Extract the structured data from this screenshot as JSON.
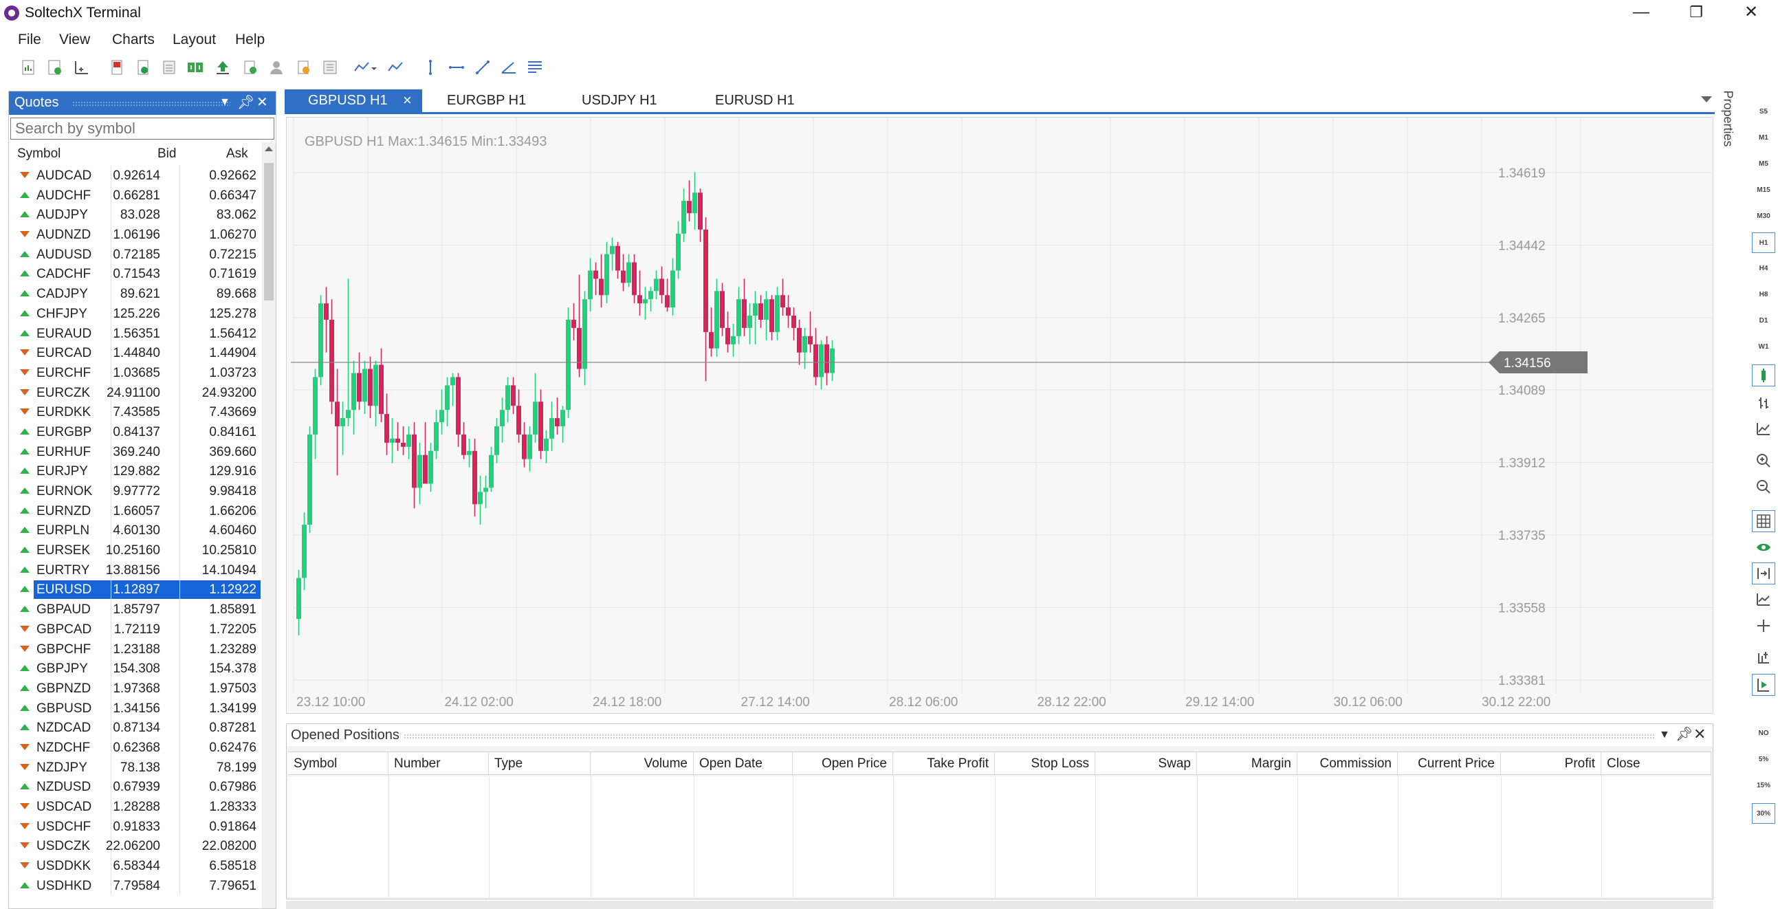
{
  "window": {
    "title": "SoltechX Terminal",
    "minimize": "—",
    "restore": "❐",
    "close": "✕"
  },
  "menu": [
    "File",
    "View",
    "Charts",
    "Layout",
    "Help"
  ],
  "quotes": {
    "title": "Quotes",
    "search_placeholder": "Search by symbol",
    "columns": [
      "Symbol",
      "Bid",
      "Ask"
    ],
    "selected_symbol": "EURUSD",
    "rows": [
      {
        "symbol": "AUDCAD",
        "bid": "0.92614",
        "ask": "0.92662",
        "dir": "down"
      },
      {
        "symbol": "AUDCHF",
        "bid": "0.66281",
        "ask": "0.66347",
        "dir": "up"
      },
      {
        "symbol": "AUDJPY",
        "bid": "83.028",
        "ask": "83.062",
        "dir": "up"
      },
      {
        "symbol": "AUDNZD",
        "bid": "1.06196",
        "ask": "1.06270",
        "dir": "down"
      },
      {
        "symbol": "AUDUSD",
        "bid": "0.72185",
        "ask": "0.72215",
        "dir": "up"
      },
      {
        "symbol": "CADCHF",
        "bid": "0.71543",
        "ask": "0.71619",
        "dir": "up"
      },
      {
        "symbol": "CADJPY",
        "bid": "89.621",
        "ask": "89.668",
        "dir": "up"
      },
      {
        "symbol": "CHFJPY",
        "bid": "125.226",
        "ask": "125.278",
        "dir": "up"
      },
      {
        "symbol": "EURAUD",
        "bid": "1.56351",
        "ask": "1.56412",
        "dir": "up"
      },
      {
        "symbol": "EURCAD",
        "bid": "1.44840",
        "ask": "1.44904",
        "dir": "down"
      },
      {
        "symbol": "EURCHF",
        "bid": "1.03685",
        "ask": "1.03723",
        "dir": "down"
      },
      {
        "symbol": "EURCZK",
        "bid": "24.91100",
        "ask": "24.93200",
        "dir": "down"
      },
      {
        "symbol": "EURDKK",
        "bid": "7.43585",
        "ask": "7.43669",
        "dir": "down"
      },
      {
        "symbol": "EURGBP",
        "bid": "0.84137",
        "ask": "0.84161",
        "dir": "up"
      },
      {
        "symbol": "EURHUF",
        "bid": "369.240",
        "ask": "369.660",
        "dir": "up"
      },
      {
        "symbol": "EURJPY",
        "bid": "129.882",
        "ask": "129.916",
        "dir": "up"
      },
      {
        "symbol": "EURNOK",
        "bid": "9.97772",
        "ask": "9.98418",
        "dir": "up"
      },
      {
        "symbol": "EURNZD",
        "bid": "1.66057",
        "ask": "1.66206",
        "dir": "up"
      },
      {
        "symbol": "EURPLN",
        "bid": "4.60130",
        "ask": "4.60460",
        "dir": "up"
      },
      {
        "symbol": "EURSEK",
        "bid": "10.25160",
        "ask": "10.25810",
        "dir": "up"
      },
      {
        "symbol": "EURTRY",
        "bid": "13.88156",
        "ask": "14.10494",
        "dir": "up"
      },
      {
        "symbol": "EURUSD",
        "bid": "1.12897",
        "ask": "1.12922",
        "dir": "up"
      },
      {
        "symbol": "GBPAUD",
        "bid": "1.85797",
        "ask": "1.85891",
        "dir": "up"
      },
      {
        "symbol": "GBPCAD",
        "bid": "1.72119",
        "ask": "1.72205",
        "dir": "down"
      },
      {
        "symbol": "GBPCHF",
        "bid": "1.23188",
        "ask": "1.23289",
        "dir": "down"
      },
      {
        "symbol": "GBPJPY",
        "bid": "154.308",
        "ask": "154.378",
        "dir": "up"
      },
      {
        "symbol": "GBPNZD",
        "bid": "1.97368",
        "ask": "1.97503",
        "dir": "up"
      },
      {
        "symbol": "GBPUSD",
        "bid": "1.34156",
        "ask": "1.34199",
        "dir": "up"
      },
      {
        "symbol": "NZDCAD",
        "bid": "0.87134",
        "ask": "0.87281",
        "dir": "up"
      },
      {
        "symbol": "NZDCHF",
        "bid": "0.62368",
        "ask": "0.62476",
        "dir": "down"
      },
      {
        "symbol": "NZDJPY",
        "bid": "78.138",
        "ask": "78.199",
        "dir": "down"
      },
      {
        "symbol": "NZDUSD",
        "bid": "0.67939",
        "ask": "0.67986",
        "dir": "up"
      },
      {
        "symbol": "USDCAD",
        "bid": "1.28288",
        "ask": "1.28333",
        "dir": "down"
      },
      {
        "symbol": "USDCHF",
        "bid": "0.91833",
        "ask": "0.91864",
        "dir": "down"
      },
      {
        "symbol": "USDCZK",
        "bid": "22.06200",
        "ask": "22.08200",
        "dir": "down"
      },
      {
        "symbol": "USDDKK",
        "bid": "6.58344",
        "ask": "6.58518",
        "dir": "down"
      },
      {
        "symbol": "USDHKD",
        "bid": "7.79584",
        "ask": "7.79651",
        "dir": "up"
      }
    ]
  },
  "tabs": [
    "GBPUSD H1",
    "EURGBP H1",
    "USDJPY H1",
    "EURUSD H1"
  ],
  "tab_close": "×",
  "chart": {
    "info": "GBPUSD H1  Max:1.34615 Min:1.33493",
    "current_price": "1.34156",
    "colors": {
      "bull": "#1fd17a",
      "bear": "#d6245a",
      "grid": "#e4e4e4",
      "price_line": "#888888",
      "price_tag": "#777777"
    }
  },
  "chart_data": {
    "type": "candlestick",
    "symbol": "GBPUSD",
    "timeframe": "H1",
    "ylim": [
      1.333,
      1.347
    ],
    "y_ticks": [
      "1.34619",
      "1.34442",
      "1.34265",
      "1.34089",
      "1.33912",
      "1.33735",
      "1.33558",
      "1.33381"
    ],
    "y_tick_values": [
      1.34619,
      1.34442,
      1.34265,
      1.34089,
      1.33912,
      1.33735,
      1.33558,
      1.33381
    ],
    "x_ticks": [
      "23.12 10:00",
      "24.12 02:00",
      "24.12 18:00",
      "27.12 14:00",
      "28.12 06:00",
      "28.12 22:00",
      "29.12 14:00",
      "30.12 06:00",
      "30.12 22:00"
    ],
    "current_price": 1.34156,
    "candles": [
      [
        1.3353,
        1.3365,
        1.3349,
        1.3363
      ],
      [
        1.3363,
        1.3379,
        1.336,
        1.3376
      ],
      [
        1.3376,
        1.34,
        1.3374,
        1.3398
      ],
      [
        1.3398,
        1.3414,
        1.3392,
        1.3412
      ],
      [
        1.3412,
        1.3432,
        1.341,
        1.343
      ],
      [
        1.343,
        1.3434,
        1.3418,
        1.3426
      ],
      [
        1.3426,
        1.3431,
        1.3403,
        1.3406
      ],
      [
        1.3406,
        1.3414,
        1.3388,
        1.34
      ],
      [
        1.34,
        1.3406,
        1.3393,
        1.3402
      ],
      [
        1.3402,
        1.3436,
        1.34,
        1.3404
      ],
      [
        1.3404,
        1.3416,
        1.3398,
        1.3413
      ],
      [
        1.3413,
        1.3418,
        1.3404,
        1.3406
      ],
      [
        1.3406,
        1.3416,
        1.3403,
        1.3414
      ],
      [
        1.3414,
        1.3417,
        1.3402,
        1.3405
      ],
      [
        1.3405,
        1.3416,
        1.34,
        1.3415
      ],
      [
        1.3415,
        1.3419,
        1.3401,
        1.3403
      ],
      [
        1.3403,
        1.3408,
        1.3393,
        1.3396
      ],
      [
        1.3396,
        1.3402,
        1.3391,
        1.3397
      ],
      [
        1.3397,
        1.3401,
        1.3394,
        1.3396
      ],
      [
        1.3396,
        1.34,
        1.3393,
        1.3395
      ],
      [
        1.3395,
        1.34,
        1.3392,
        1.3398
      ],
      [
        1.3398,
        1.3401,
        1.338,
        1.3385
      ],
      [
        1.3385,
        1.3396,
        1.3381,
        1.3393
      ],
      [
        1.3393,
        1.3401,
        1.339,
        1.3386
      ],
      [
        1.3386,
        1.3396,
        1.3384,
        1.3394
      ],
      [
        1.3394,
        1.3404,
        1.3392,
        1.3401
      ],
      [
        1.3401,
        1.3409,
        1.3398,
        1.3404
      ],
      [
        1.3404,
        1.3412,
        1.34,
        1.341
      ],
      [
        1.341,
        1.3413,
        1.3405,
        1.3412
      ],
      [
        1.3412,
        1.3413,
        1.3395,
        1.3398
      ],
      [
        1.3398,
        1.3401,
        1.3392,
        1.3393
      ],
      [
        1.3393,
        1.3397,
        1.339,
        1.3394
      ],
      [
        1.3394,
        1.3397,
        1.3378,
        1.3381
      ],
      [
        1.3381,
        1.3388,
        1.3376,
        1.3384
      ],
      [
        1.3384,
        1.3388,
        1.338,
        1.3385
      ],
      [
        1.3385,
        1.3395,
        1.3384,
        1.3393
      ],
      [
        1.3393,
        1.3402,
        1.3391,
        1.34
      ],
      [
        1.34,
        1.3407,
        1.3396,
        1.3404
      ],
      [
        1.3404,
        1.3412,
        1.3401,
        1.341
      ],
      [
        1.341,
        1.3412,
        1.3403,
        1.3405
      ],
      [
        1.3405,
        1.3409,
        1.3396,
        1.3398
      ],
      [
        1.3398,
        1.3401,
        1.339,
        1.3392
      ],
      [
        1.3392,
        1.34,
        1.3389,
        1.3398
      ],
      [
        1.3398,
        1.3413,
        1.3396,
        1.3406
      ],
      [
        1.3406,
        1.3409,
        1.3392,
        1.3394
      ],
      [
        1.3394,
        1.3399,
        1.3391,
        1.3397
      ],
      [
        1.3397,
        1.3406,
        1.3394,
        1.3402
      ],
      [
        1.3402,
        1.3407,
        1.3398,
        1.34
      ],
      [
        1.34,
        1.3405,
        1.3396,
        1.3404
      ],
      [
        1.3404,
        1.3429,
        1.3402,
        1.3426
      ],
      [
        1.3426,
        1.343,
        1.3421,
        1.3424
      ],
      [
        1.3424,
        1.3437,
        1.3412,
        1.3414
      ],
      [
        1.3414,
        1.3433,
        1.341,
        1.3431
      ],
      [
        1.3431,
        1.3441,
        1.3428,
        1.3438
      ],
      [
        1.3438,
        1.344,
        1.3432,
        1.3436
      ],
      [
        1.3436,
        1.3442,
        1.3429,
        1.3432
      ],
      [
        1.3432,
        1.3445,
        1.343,
        1.3442
      ],
      [
        1.3442,
        1.3446,
        1.3438,
        1.3444
      ],
      [
        1.3444,
        1.3445,
        1.3436,
        1.3438
      ],
      [
        1.3438,
        1.3442,
        1.3433,
        1.3435
      ],
      [
        1.3435,
        1.3442,
        1.3434,
        1.344
      ],
      [
        1.344,
        1.3442,
        1.343,
        1.3432
      ],
      [
        1.3432,
        1.3438,
        1.3427,
        1.343
      ],
      [
        1.343,
        1.3434,
        1.3426,
        1.3431
      ],
      [
        1.3431,
        1.3434,
        1.3428,
        1.3433
      ],
      [
        1.3433,
        1.3438,
        1.3431,
        1.3436
      ],
      [
        1.3436,
        1.3439,
        1.343,
        1.3432
      ],
      [
        1.3432,
        1.3436,
        1.3428,
        1.3429
      ],
      [
        1.3429,
        1.3441,
        1.3427,
        1.3438
      ],
      [
        1.3438,
        1.345,
        1.3436,
        1.3447
      ],
      [
        1.3447,
        1.3458,
        1.3445,
        1.3455
      ],
      [
        1.3455,
        1.346,
        1.345,
        1.3452
      ],
      [
        1.3452,
        1.3462,
        1.3448,
        1.3457
      ],
      [
        1.3457,
        1.3458,
        1.3445,
        1.3448
      ],
      [
        1.3448,
        1.3451,
        1.3411,
        1.3423
      ],
      [
        1.3423,
        1.3429,
        1.3417,
        1.3419
      ],
      [
        1.3419,
        1.3436,
        1.3417,
        1.3433
      ],
      [
        1.3433,
        1.3435,
        1.3422,
        1.3424
      ],
      [
        1.3424,
        1.3428,
        1.3418,
        1.342
      ],
      [
        1.342,
        1.3425,
        1.3417,
        1.3422
      ],
      [
        1.3422,
        1.3434,
        1.342,
        1.3431
      ],
      [
        1.3431,
        1.3436,
        1.3422,
        1.3424
      ],
      [
        1.3424,
        1.343,
        1.342,
        1.3427
      ],
      [
        1.3427,
        1.3433,
        1.342,
        1.343
      ],
      [
        1.343,
        1.3432,
        1.3424,
        1.3426
      ],
      [
        1.3426,
        1.3433,
        1.3421,
        1.3431
      ],
      [
        1.3431,
        1.3432,
        1.3421,
        1.3423
      ],
      [
        1.3423,
        1.3434,
        1.3421,
        1.3432
      ],
      [
        1.3432,
        1.3436,
        1.3427,
        1.3429
      ],
      [
        1.3429,
        1.3432,
        1.3424,
        1.3427
      ],
      [
        1.3427,
        1.3429,
        1.3421,
        1.3424
      ],
      [
        1.3424,
        1.3426,
        1.3415,
        1.3418
      ],
      [
        1.3418,
        1.3424,
        1.3414,
        1.3422
      ],
      [
        1.3422,
        1.3428,
        1.3418,
        1.342
      ],
      [
        1.342,
        1.3424,
        1.341,
        1.3412
      ],
      [
        1.3412,
        1.3421,
        1.3409,
        1.342
      ],
      [
        1.342,
        1.3422,
        1.341,
        1.3413
      ],
      [
        1.3413,
        1.3421,
        1.3411,
        1.3419
      ]
    ]
  },
  "right_bar": {
    "properties": "Properties",
    "timeframes": [
      "S5",
      "M1",
      "M5",
      "M15",
      "M30",
      "H1",
      "H4",
      "H8",
      "D1",
      "W1"
    ],
    "selected_timeframe": "H1",
    "volumes": [
      "NO",
      "5%",
      "15%",
      "30%"
    ],
    "selected_volume": "30%"
  },
  "positions": {
    "title": "Opened Positions",
    "columns": [
      "Symbol",
      "Number",
      "Type",
      "Volume",
      "Open Date",
      "Open Price",
      "Take Profit",
      "Stop Loss",
      "Swap",
      "Margin",
      "Commission",
      "Current Price",
      "Profit",
      "Close"
    ]
  }
}
